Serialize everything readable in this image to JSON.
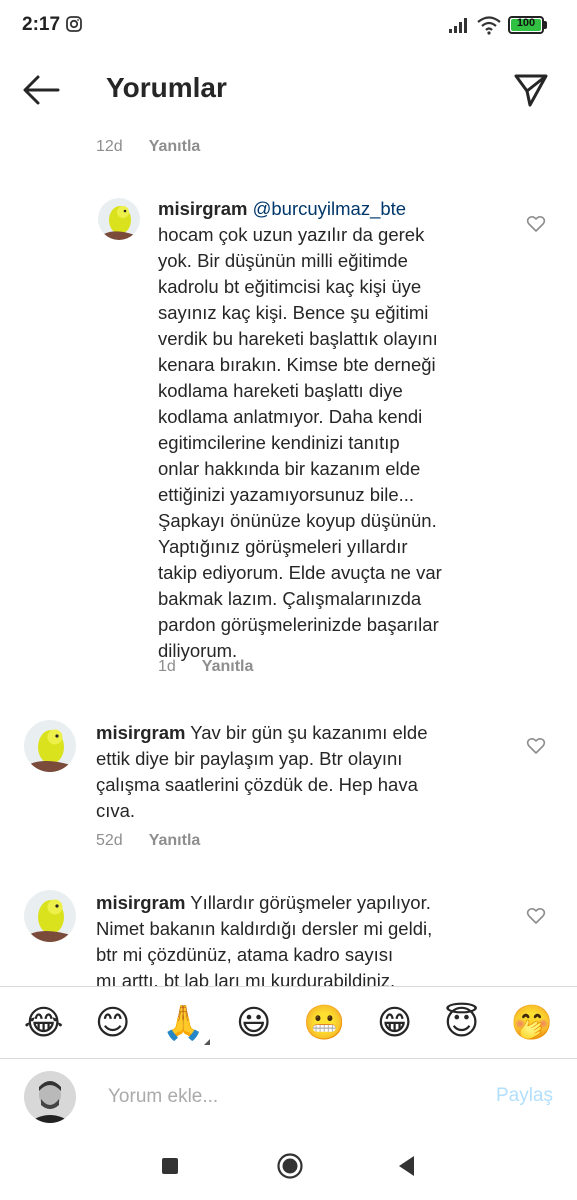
{
  "status_bar": {
    "time": "2:17",
    "battery": "100"
  },
  "header": {
    "title": "Yorumlar"
  },
  "prev_meta": {
    "time": "12d",
    "reply": "Yanıtla"
  },
  "comments": [
    {
      "username": "misirgram",
      "mention": "@burcuyilmaz_bte",
      "lines": [
        "hocam çok uzun yazılır da gerek",
        "yok. Bir düşünün milli eğitimde",
        "kadrolu bt eğitimcisi kaç kişi üye",
        "sayınız kaç kişi. Bence şu eğitimi",
        "verdik bu hareketi başlattık olayını",
        "kenara bırakın. Kimse bte derneği",
        "kodlama hareketi başlattı diye",
        "kodlama anlatmıyor. Daha kendi",
        "egitimcilerine kendinizi tanıtıp",
        "onlar hakkında bir kazanım elde",
        "ettiğinizi yazamıyorsunuz bile...",
        "Şapkayı önünüze koyup düşünün.",
        "Yaptığınız görüşmeleri yıllardır",
        "takip ediyorum. Elde avuçta ne var",
        "bakmak lazım. Çalışmalarınızda",
        "pardon görüşmelerinizde başarılar",
        "diliyorum."
      ],
      "time": "1d",
      "reply": "Yanıtla"
    },
    {
      "username": "misirgram",
      "first_line_rest": " Yav bir gün şu kazanımı elde",
      "lines": [
        "ettik diye bir paylaşım yap. Btr olayını",
        "çalışma saatlerini çözdük de. Hep hava",
        "cıva."
      ],
      "time": "52d",
      "reply": "Yanıtla"
    },
    {
      "username": "misirgram",
      "first_line_rest": " Yıllardır görüşmeler yapılıyor.",
      "lines": [
        "Nimet bakanın kaldırdığı dersler mi geldi,",
        "btr mi çözdünüz, atama kadro sayısı",
        "mı arttı, bt lab ları mı kurdurabildiniz,"
      ]
    }
  ],
  "emoji_bar": [
    "😂",
    "😊",
    "🙏",
    "😃",
    "😬",
    "😁",
    "😇",
    "🤭"
  ],
  "input": {
    "placeholder": "Yorum ekle...",
    "value": "",
    "share_label": "Paylaş"
  },
  "colors": {
    "text": "#262626",
    "meta": "#8e8e8e",
    "mention": "#00376b",
    "share_disabled": "#b2dffc",
    "battery": "#30c143"
  }
}
